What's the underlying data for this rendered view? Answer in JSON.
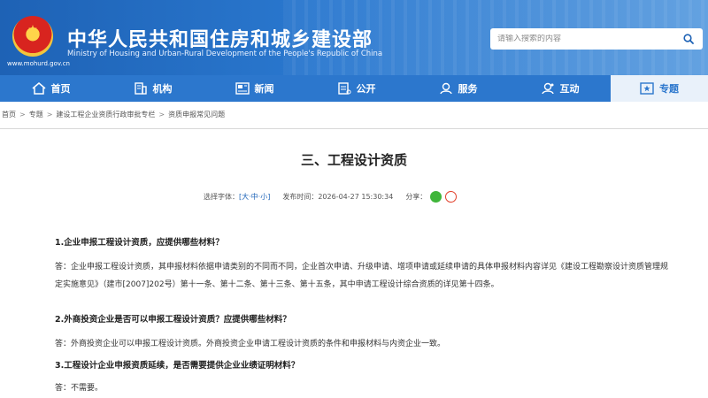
{
  "header": {
    "site_title": "中华人民共和国住房和城乡建设部",
    "site_subtitle": "Ministry of Housing and Urban-Rural Development of the People's Republic of China",
    "domain": "www.mohurd.gov.cn",
    "search_placeholder": "请输入搜索的内容"
  },
  "nav": {
    "items": [
      {
        "label": "首页",
        "icon": "home-icon"
      },
      {
        "label": "机构",
        "icon": "building-icon"
      },
      {
        "label": "新闻",
        "icon": "newspaper-icon"
      },
      {
        "label": "公开",
        "icon": "document-icon"
      },
      {
        "label": "服务",
        "icon": "service-icon"
      },
      {
        "label": "互动",
        "icon": "chat-icon"
      },
      {
        "label": "专题",
        "icon": "topic-icon"
      }
    ],
    "active_index": 6
  },
  "breadcrumb": [
    "首页",
    "专题",
    "建设工程企业资质行政审批专栏",
    "资质申报常见问题"
  ],
  "article": {
    "title": "三、工程设计资质",
    "font_size_label": "选择字体：",
    "font_size_open": "[",
    "font_large": "大",
    "font_mid": "中",
    "font_small": "小",
    "font_size_close": "]",
    "dot": "·",
    "publish_label": "发布时间：",
    "publish_time": "2026-04-27 15:30:34",
    "share_label": "分享：",
    "qa": [
      {
        "q": "1.企业申报工程设计资质，应提供哪些材料？",
        "a": "答：企业申报工程设计资质，其申报材料依据申请类别的不同而不同，企业首次申请、升级申请、增项申请或延续申请的具体申报材料内容详见《建设工程勘察设计资质管理规定实施意见》（建市[2007]202号）第十一条、第十二条、第十三条、第十五条，其中申请工程设计综合资质的详见第十四条。"
      },
      {
        "q": "2.外商投资企业是否可以申报工程设计资质？应提供哪些材料？",
        "a": "答：外商投资企业可以申报工程设计资质。外商投资企业申请工程设计资质的条件和申报材料与内资企业一致。"
      },
      {
        "q": "3.工程设计企业申报资质延续，是否需要提供企业业绩证明材料？",
        "a": "答：不需要。"
      }
    ]
  },
  "colors": {
    "header_blue": "#1e62b5",
    "nav_blue": "#2c77cd",
    "link_blue": "#1e64b8",
    "wechat_green": "#3fb53a",
    "weibo_red": "#e2412c"
  }
}
